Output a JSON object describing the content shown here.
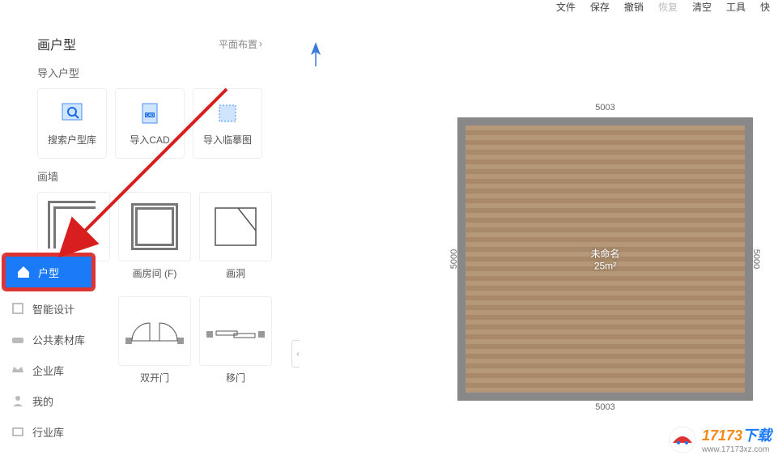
{
  "topbar": {
    "file": "文件",
    "save": "保存",
    "undo": "撤销",
    "redo": "恢复",
    "clear": "清空",
    "tool": "工具",
    "quick": "快"
  },
  "panel": {
    "title": "画户型",
    "mode": "平面布置",
    "section_import": "导入户型",
    "cards": {
      "search": "搜索户型库",
      "cad": "导入CAD",
      "trace": "导入临摹图"
    },
    "section_wall": "画墙",
    "walls": {
      "room": "画房间 (F)",
      "hole": "画洞",
      "double_door": "双开门",
      "sliding_door": "移门"
    }
  },
  "nav": {
    "layout": "户型",
    "smart": "智能设计",
    "public": "公共素材库",
    "enterprise": "企业库",
    "mine": "我的",
    "industry": "行业库"
  },
  "canvas": {
    "dim_top": "5003",
    "dim_bottom": "5003",
    "dim_left": "5000",
    "dim_right": "5000",
    "room_name": "未命名",
    "room_area": "25m²"
  },
  "watermark": {
    "brand_a": "17173",
    "brand_b": "下载",
    "url": "www.17173xz.com"
  }
}
